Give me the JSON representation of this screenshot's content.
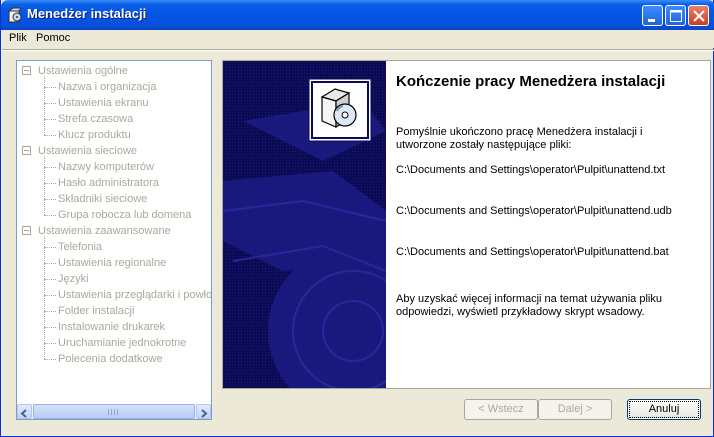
{
  "window": {
    "title": "Menedżer instalacji"
  },
  "menu": {
    "items": [
      "Plik",
      "Pomoc"
    ]
  },
  "tree": {
    "groups": [
      {
        "label": "Ustawienia ogólne",
        "children": [
          "Nazwa i organizacja",
          "Ustawienia ekranu",
          "Strefa czasowa",
          "Klucz produktu"
        ]
      },
      {
        "label": "Ustawienia sieciowe",
        "children": [
          "Nazwy komputerów",
          "Hasło administratora",
          "Składniki sieciowe",
          "Grupa robocza lub domena"
        ]
      },
      {
        "label": "Ustawienia zaawansowane",
        "children": [
          "Telefonia",
          "Ustawienia regionalne",
          "Języki",
          "Ustawienia przeglądarki i powłoki",
          "Folder instalacji",
          "Instalowanie drukarek",
          "Uruchamianie jednokrotne",
          "Polecenia dodatkowe"
        ]
      }
    ]
  },
  "content": {
    "heading": "Kończenie pracy Menedżera instalacji",
    "intro": "Pomyślnie ukończono pracę Menedżera instalacji i utworzone zostały następujące pliki:",
    "files": [
      "C:\\Documents and Settings\\operator\\Pulpit\\unattend.txt",
      "C:\\Documents and Settings\\operator\\Pulpit\\unattend.udb",
      "C:\\Documents and Settings\\operator\\Pulpit\\unattend.bat"
    ],
    "outro": "Aby uzyskać więcej informacji na temat używania pliku odpowiedzi, wyświetl przykładowy skrypt wsadowy."
  },
  "buttons": {
    "back": "< Wstecz",
    "next": "Dalej >",
    "cancel": "Anuluj"
  },
  "colors": {
    "titlebar": "#0554E4",
    "banner": "#0B0B55",
    "disabled_text": "#ACA899"
  },
  "icons": {
    "app": "setup-box-icon",
    "banner": "setup-box-cd-icon"
  }
}
